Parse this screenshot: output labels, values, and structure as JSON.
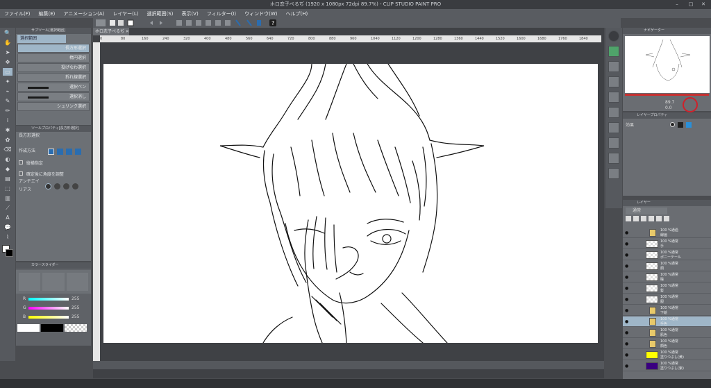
{
  "window": {
    "title": "ホロ恋子ぺるぢ (1920 x 1080px 72dpi 89.7%) - CLIP STUDIO PAINT PRO"
  },
  "menu": [
    "ファイル(F)",
    "編集(E)",
    "アニメーション(A)",
    "レイヤー(L)",
    "選択範囲(S)",
    "表示(V)",
    "フィルター(I)",
    "ウィンドウ(W)",
    "ヘルプ(H)"
  ],
  "subtool": {
    "tabs": [
      "サブツール[選択範囲]"
    ],
    "group": "選択範囲",
    "items": [
      "長方形選択",
      "楕円選択",
      "投げなわ選択",
      "折れ線選択",
      "選択ペン",
      "選択消し",
      "シュリンク選択"
    ]
  },
  "toolprop": {
    "tab": "ツールプロパティ[長方形選択]",
    "name": "長方形選択",
    "rows": [
      "作成方法",
      "縦横指定",
      "確定後に角度を調整",
      "アンチエイリアス"
    ]
  },
  "color": {
    "tab": "カラースライダー",
    "r_label": "R",
    "g_label": "G",
    "b_label": "B",
    "r": "255",
    "g": "255",
    "b": "255"
  },
  "document": {
    "tab": "ホロ恋子ぺるぢ"
  },
  "ruler_ticks": [
    "0",
    "80",
    "160",
    "240",
    "320",
    "400",
    "480",
    "560",
    "640",
    "720",
    "800",
    "880",
    "960",
    "1040",
    "1120",
    "1200",
    "1280",
    "1360",
    "1440",
    "1520",
    "1600",
    "1680",
    "1760",
    "1840"
  ],
  "navigator": {
    "tab": "ナビゲーター",
    "zoom": "89.7",
    "angle": "0.0"
  },
  "layer_property": {
    "tab": "レイヤープロパティ",
    "effect": "効果"
  },
  "layer": {
    "tab": "レイヤー",
    "blend": "通常",
    "items": [
      {
        "kind": "folder",
        "text": "100 %通過\n線画"
      },
      {
        "kind": "layer",
        "text": "100 %通常\n手"
      },
      {
        "kind": "layer",
        "text": "100 %通常\nポニーテール"
      },
      {
        "kind": "layer",
        "text": "100 %通常\n顔"
      },
      {
        "kind": "layer",
        "text": "100 %通常\n瞳"
      },
      {
        "kind": "layer",
        "text": "100 %通常\n髪"
      },
      {
        "kind": "layer",
        "text": "100 %通常\n服"
      },
      {
        "kind": "folder",
        "text": "100 %通常\n下絵"
      },
      {
        "kind": "folder",
        "text": "100 %通常\n手色"
      },
      {
        "kind": "folder",
        "text": "100 %通常\n肌色"
      },
      {
        "kind": "folder",
        "text": "100 %通常\n顔色"
      },
      {
        "kind": "fill",
        "text": "100 %通常\n塗りつぶし(黄)",
        "color": "#ffff00"
      },
      {
        "kind": "fill",
        "text": "100 %通常\n塗りつぶし(紫)",
        "color": "#3a0080"
      }
    ]
  },
  "accent": {
    "selection": "#9fb6c8",
    "highlight_circle": "#d0202a",
    "nav_red": "#c83030"
  }
}
